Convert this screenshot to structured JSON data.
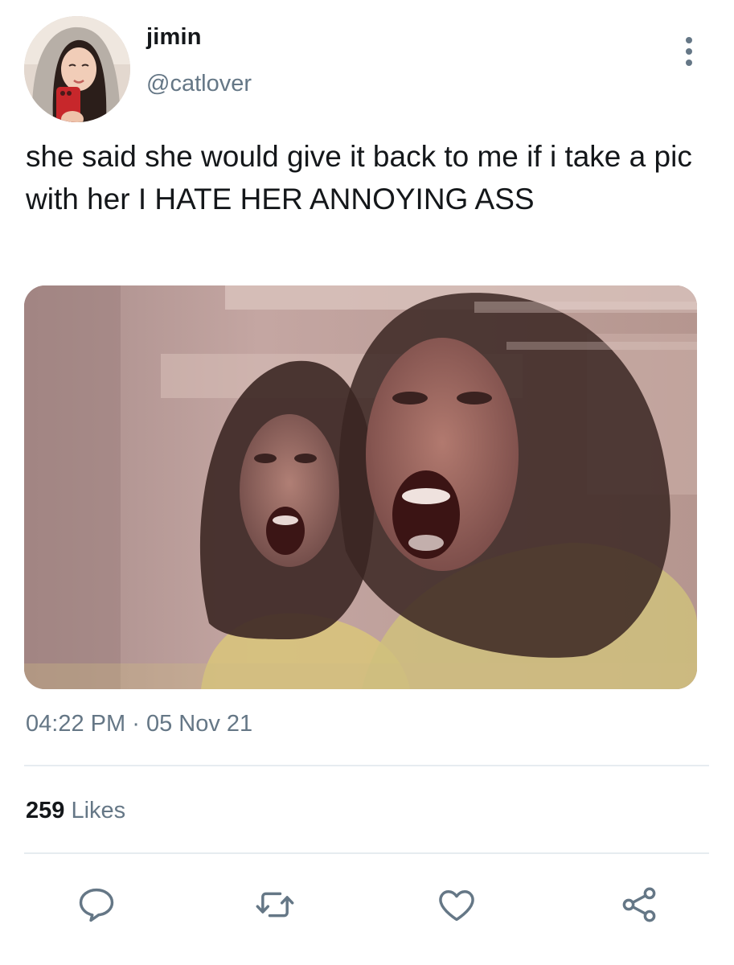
{
  "user": {
    "display_name": "jimin",
    "handle": "@catlover"
  },
  "tweet": {
    "text": "she said she would give it back to me if i take a pic with her I HATE HER ANNOYING ASS",
    "time": "04:22 PM",
    "separator": "·",
    "date": "05 Nov 21"
  },
  "stats": {
    "likes_count": "259",
    "likes_label": "Likes"
  },
  "icons": {
    "more": "more-vertical-icon",
    "reply": "reply-icon",
    "retweet": "retweet-icon",
    "like": "heart-icon",
    "share": "share-icon"
  },
  "colors": {
    "text_primary": "#14171a",
    "text_secondary": "#657786",
    "divider": "#e6ecf0"
  }
}
